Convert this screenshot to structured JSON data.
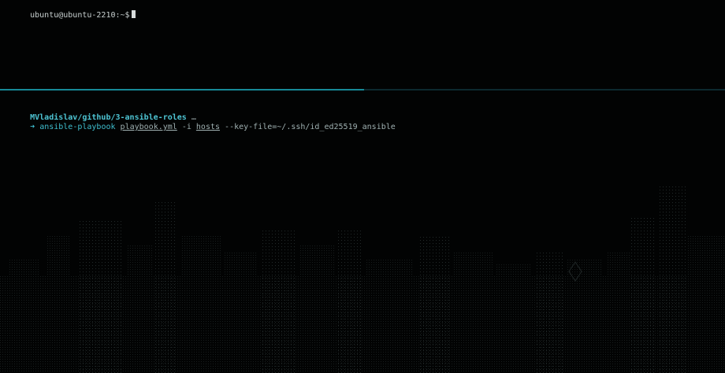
{
  "top_pane": {
    "prompt": "ubuntu@ubuntu-2210:~$"
  },
  "bottom_pane": {
    "cwd": "MVladislav/github/3-ansible-roles",
    "ellipsis": "…",
    "arrow": "➜",
    "command": "ansible-playbook",
    "playbook": "playbook.yml",
    "inventory_flag": "-i",
    "inventory": "hosts",
    "key_option": "--key-file=~/.ssh/id_ed25519_ansible"
  },
  "colors": {
    "background": "#020303",
    "accent": "#3fbfcf",
    "divider_active": "#178a98"
  }
}
